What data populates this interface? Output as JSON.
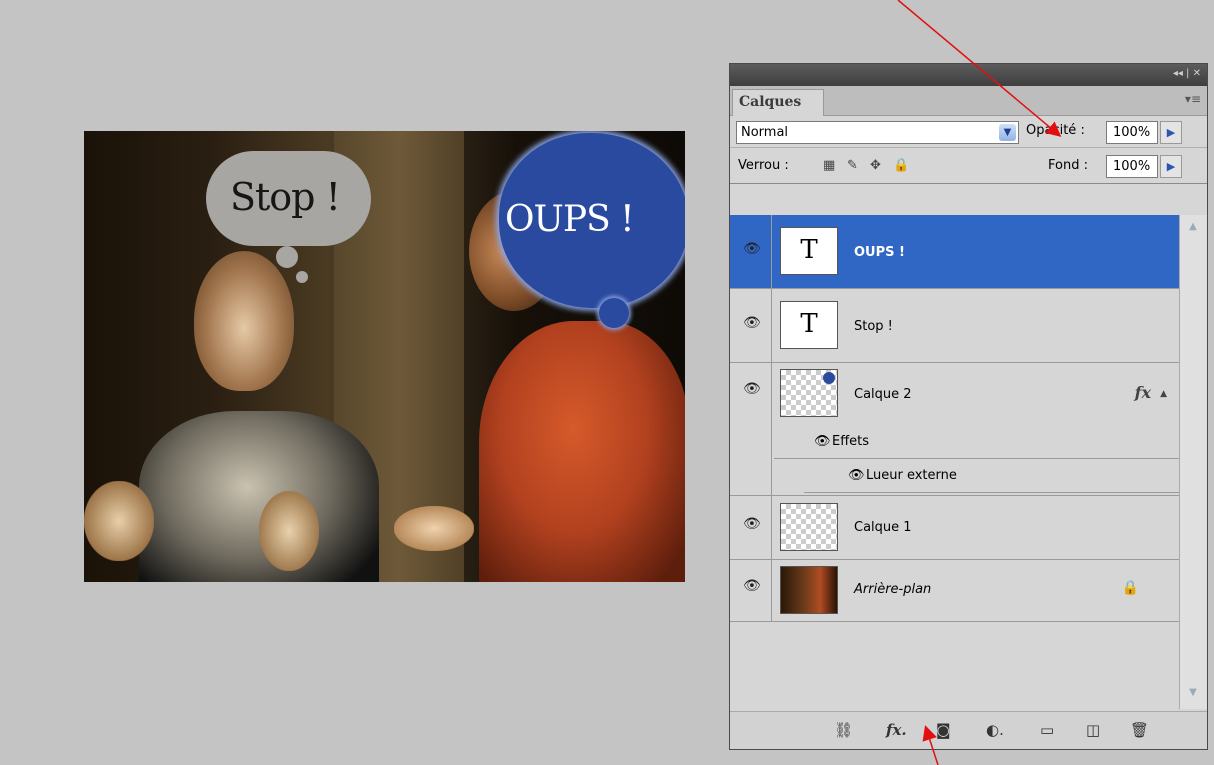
{
  "canvas": {
    "bubble_left_text": "Stop !",
    "bubble_right_text": "OUPS !"
  },
  "panel": {
    "tab_label": "Calques",
    "blend_mode": "Normal",
    "opacity_label": "Opacité :",
    "opacity_value": "100%",
    "lock_label": "Verrou :",
    "fill_label": "Fond :",
    "fill_value": "100%",
    "layers": [
      {
        "name": "OUPS !",
        "kind": "text",
        "selected": true
      },
      {
        "name": "Stop !",
        "kind": "text",
        "selected": false
      },
      {
        "name": "Calque 2",
        "kind": "pixel",
        "selected": false,
        "effects_label": "Effets",
        "effect_name": "Lueur externe"
      },
      {
        "name": "Calque 1",
        "kind": "pixel",
        "selected": false
      },
      {
        "name": "Arrière-plan",
        "kind": "background",
        "selected": false,
        "locked": true
      }
    ]
  },
  "colors": {
    "selection": "#3067c4",
    "annotation_arrow": "#e01010",
    "bubble_blue": "#2a4aa0"
  }
}
